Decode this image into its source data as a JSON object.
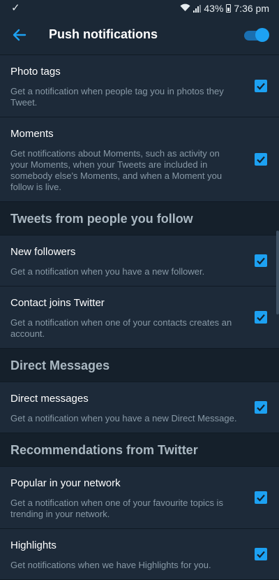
{
  "status": {
    "battery": "43%",
    "time": "7:36 pm"
  },
  "header": {
    "title": "Push notifications"
  },
  "sections": {
    "top": [
      {
        "title": "Photo tags",
        "desc": "Get a notification when people tag you in photos they Tweet."
      },
      {
        "title": "Moments",
        "desc": "Get notifications about Moments, such as activity on your Moments, when your Tweets are included in somebody else's Moments, and when a Moment you follow is live."
      }
    ],
    "follow": {
      "title": "Tweets from people you follow",
      "items": [
        {
          "title": "New followers",
          "desc": "Get a notification when you have a new follower."
        },
        {
          "title": "Contact joins Twitter",
          "desc": "Get a notification when one of your contacts creates an account."
        }
      ]
    },
    "dm": {
      "title": "Direct Messages",
      "items": [
        {
          "title": "Direct messages",
          "desc": "Get a notification when you have a new Direct Message."
        }
      ]
    },
    "rec": {
      "title": "Recommendations from Twitter",
      "items": [
        {
          "title": "Popular in your network",
          "desc": "Get a notification when one of your favourite topics is trending in your network."
        },
        {
          "title": "Highlights",
          "desc": "Get notifications when we have Highlights for you."
        }
      ]
    }
  },
  "colors": {
    "accent": "#1da1f2",
    "background": "#1b2836",
    "section_bg": "#15202b"
  }
}
